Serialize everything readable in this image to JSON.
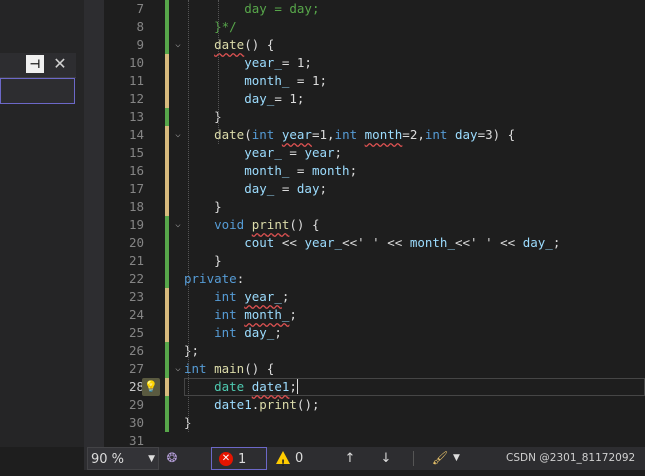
{
  "status": {
    "zoom": "90 %",
    "errors": "1",
    "warnings": "0",
    "credit": "CSDN @2301_81172092"
  },
  "code_lines": [
    {
      "n": "7",
      "segs": [
        {
          "t": "        "
        },
        {
          "t": "day = day;",
          "c": "cm"
        }
      ]
    },
    {
      "n": "8",
      "segs": [
        {
          "t": "    "
        },
        {
          "t": "}*/",
          "c": "cm"
        }
      ]
    },
    {
      "n": "9",
      "segs": [
        {
          "t": "    "
        },
        {
          "t": "date",
          "c": "fn sq"
        },
        {
          "t": "() {"
        }
      ]
    },
    {
      "n": "10",
      "segs": [
        {
          "t": "        "
        },
        {
          "t": "year_",
          "c": "va"
        },
        {
          "t": "= 1;"
        }
      ]
    },
    {
      "n": "11",
      "segs": [
        {
          "t": "        "
        },
        {
          "t": "month_",
          "c": "va"
        },
        {
          "t": " = 1;"
        }
      ]
    },
    {
      "n": "12",
      "segs": [
        {
          "t": "        "
        },
        {
          "t": "day_",
          "c": "va"
        },
        {
          "t": "= 1;"
        }
      ]
    },
    {
      "n": "13",
      "segs": [
        {
          "t": "    "
        },
        {
          "t": "}"
        }
      ]
    },
    {
      "n": "14",
      "segs": [
        {
          "t": "    "
        },
        {
          "t": "date",
          "c": "fn"
        },
        {
          "t": "("
        },
        {
          "t": "int",
          "c": "kw"
        },
        {
          "t": " "
        },
        {
          "t": "year",
          "c": "va sq"
        },
        {
          "t": "=1,"
        },
        {
          "t": "int",
          "c": "kw"
        },
        {
          "t": " "
        },
        {
          "t": "month",
          "c": "va sq"
        },
        {
          "t": "=2,"
        },
        {
          "t": "int",
          "c": "kw"
        },
        {
          "t": " "
        },
        {
          "t": "day",
          "c": "va"
        },
        {
          "t": "=3) {"
        }
      ]
    },
    {
      "n": "15",
      "segs": [
        {
          "t": "        "
        },
        {
          "t": "year_",
          "c": "va"
        },
        {
          "t": " = "
        },
        {
          "t": "year",
          "c": "va"
        },
        {
          "t": ";"
        }
      ]
    },
    {
      "n": "16",
      "segs": [
        {
          "t": "        "
        },
        {
          "t": "month_",
          "c": "va"
        },
        {
          "t": " = "
        },
        {
          "t": "month",
          "c": "va"
        },
        {
          "t": ";"
        }
      ]
    },
    {
      "n": "17",
      "segs": [
        {
          "t": "        "
        },
        {
          "t": "day_",
          "c": "va"
        },
        {
          "t": " = "
        },
        {
          "t": "day",
          "c": "va"
        },
        {
          "t": ";"
        }
      ]
    },
    {
      "n": "18",
      "segs": [
        {
          "t": "    "
        },
        {
          "t": "}"
        }
      ]
    },
    {
      "n": "19",
      "segs": [
        {
          "t": "    "
        },
        {
          "t": "void",
          "c": "kw"
        },
        {
          "t": " "
        },
        {
          "t": "print",
          "c": "fn sq"
        },
        {
          "t": "() {"
        }
      ]
    },
    {
      "n": "20",
      "segs": [
        {
          "t": "        "
        },
        {
          "t": "cout",
          "c": "va"
        },
        {
          "t": " << "
        },
        {
          "t": "year_",
          "c": "va"
        },
        {
          "t": "<<' ' << "
        },
        {
          "t": "month_",
          "c": "va"
        },
        {
          "t": "<<' ' << "
        },
        {
          "t": "day_",
          "c": "va"
        },
        {
          "t": ";"
        }
      ]
    },
    {
      "n": "21",
      "segs": [
        {
          "t": "    "
        },
        {
          "t": "}"
        }
      ]
    },
    {
      "n": "22",
      "segs": [
        {
          "t": "private",
          "c": "kw"
        },
        {
          "t": ":"
        }
      ]
    },
    {
      "n": "23",
      "segs": [
        {
          "t": "    "
        },
        {
          "t": "int",
          "c": "kw"
        },
        {
          "t": " "
        },
        {
          "t": "year_",
          "c": "va sq"
        },
        {
          "t": ";"
        }
      ]
    },
    {
      "n": "24",
      "segs": [
        {
          "t": "    "
        },
        {
          "t": "int",
          "c": "kw"
        },
        {
          "t": " "
        },
        {
          "t": "month_",
          "c": "va sq"
        },
        {
          "t": ";"
        }
      ]
    },
    {
      "n": "25",
      "segs": [
        {
          "t": "    "
        },
        {
          "t": "int",
          "c": "kw"
        },
        {
          "t": " "
        },
        {
          "t": "day_",
          "c": "va"
        },
        {
          "t": ";"
        }
      ]
    },
    {
      "n": "26",
      "segs": [
        {
          "t": "};"
        }
      ]
    },
    {
      "n": "27",
      "segs": [
        {
          "t": "int",
          "c": "kw"
        },
        {
          "t": " "
        },
        {
          "t": "main",
          "c": "fn"
        },
        {
          "t": "() {"
        }
      ]
    },
    {
      "n": "28",
      "segs": [
        {
          "t": "    "
        },
        {
          "t": "date",
          "c": "ty"
        },
        {
          "t": " "
        },
        {
          "t": "date1",
          "c": "va sq"
        },
        {
          "t": ";",
          "c": "caret"
        }
      ]
    },
    {
      "n": "29",
      "segs": [
        {
          "t": "    "
        },
        {
          "t": "date1",
          "c": "va"
        },
        {
          "t": "."
        },
        {
          "t": "print",
          "c": "fn"
        },
        {
          "t": "();"
        }
      ]
    },
    {
      "n": "30",
      "segs": [
        {
          "t": "}"
        }
      ]
    },
    {
      "n": "31",
      "segs": []
    }
  ]
}
